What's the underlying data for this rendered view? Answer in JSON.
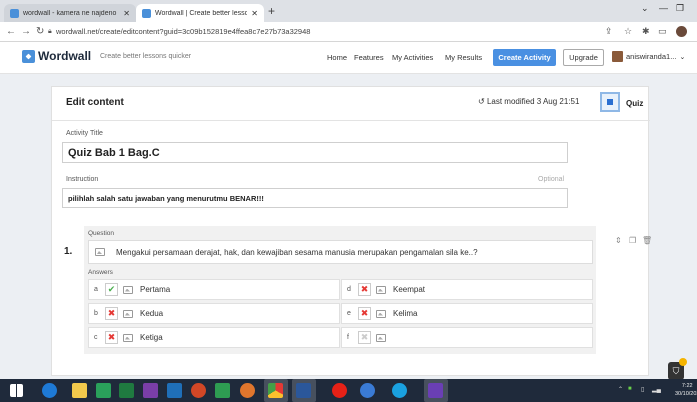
{
  "browser": {
    "tabs": [
      {
        "title": "wordwall - kamera ne najdeno",
        "icon": "wordwall-favicon"
      },
      {
        "title": "Wordwall | Create better lessons",
        "icon": "wordwall-favicon"
      }
    ],
    "url": "wordwall.net/create/editcontent?guid=3c09b152819e4ffea8c7e27b73a32948"
  },
  "header": {
    "brand": "Wordwall",
    "tagline": "Create better lessons quicker",
    "nav": [
      "Home",
      "Features",
      "My Activities",
      "My Results"
    ],
    "create_label": "Create Activity",
    "upgrade_label": "Upgrade",
    "username": "aniswiranda1..."
  },
  "editor": {
    "heading": "Edit content",
    "last_modified": "Last modified 3 Aug 21:51",
    "template_label": "Quiz",
    "title_label": "Activity Title",
    "title_value": "Quiz Bab 1 Bag.C",
    "instruction_label": "Instruction",
    "optional_label": "Optional",
    "instruction_value": "pilihlah salah satu jawaban yang menurutmu BENAR!!!",
    "question": {
      "number": "1.",
      "label": "Question",
      "text": "Mengakui persamaan derajat, hak, dan kewajiban sesama manusia merupakan pengamalan sila ke..?",
      "answers_label": "Answers",
      "answers": [
        {
          "letter": "a",
          "text": "Pertama",
          "correct": true
        },
        {
          "letter": "b",
          "text": "Kedua",
          "correct": false
        },
        {
          "letter": "c",
          "text": "Ketiga",
          "correct": false
        },
        {
          "letter": "d",
          "text": "Keempat",
          "correct": false
        },
        {
          "letter": "e",
          "text": "Kelima",
          "correct": false
        },
        {
          "letter": "f",
          "text": "",
          "correct": null
        }
      ]
    }
  },
  "taskbar": {
    "clock_time": "7:22",
    "clock_date": "30/10/202"
  },
  "colors": {
    "accent": "#4a90e2",
    "correct": "#4caf50",
    "wrong": "#e53935"
  }
}
